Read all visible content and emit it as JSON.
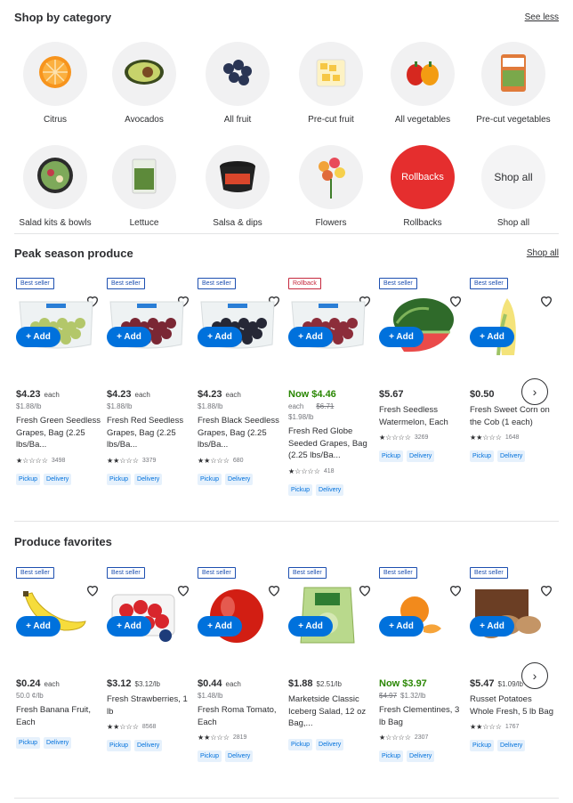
{
  "category": {
    "title": "Shop by category",
    "link": "See less",
    "items": [
      {
        "label": "Citrus",
        "icon": "orange-icon"
      },
      {
        "label": "Avocados",
        "icon": "avocado-icon"
      },
      {
        "label": "All fruit",
        "icon": "blueberries-icon"
      },
      {
        "label": "Pre-cut fruit",
        "icon": "pineapple-chunks-icon"
      },
      {
        "label": "All vegetables",
        "icon": "peppers-icon"
      },
      {
        "label": "Pre-cut vegetables",
        "icon": "veggie-bag-icon"
      },
      {
        "label": "Salad kits & bowls",
        "icon": "salad-bowl-icon"
      },
      {
        "label": "Lettuce",
        "icon": "lettuce-icon"
      },
      {
        "label": "Salsa & dips",
        "icon": "salsa-tub-icon"
      },
      {
        "label": "Flowers",
        "icon": "flowers-icon"
      },
      {
        "label": "Rollbacks",
        "circle_text": "Rollbacks"
      },
      {
        "label": "Shop all",
        "circle_text": "Shop all"
      }
    ]
  },
  "peak": {
    "title": "Peak season produce",
    "link": "Shop all",
    "products": [
      {
        "badge": "Best seller",
        "price": "$4.23",
        "each": "each",
        "unit": "$1.88/lb",
        "name": "Fresh Green Seedless Grapes, Bag (2.25 lbs/Ba...",
        "reviews": "3498",
        "stars": "★☆☆☆☆",
        "tags": [
          "Pickup",
          "Delivery"
        ]
      },
      {
        "badge": "Best seller",
        "price": "$4.23",
        "each": "each",
        "unit": "$1.88/lb",
        "name": "Fresh Red Seedless Grapes, Bag (2.25 lbs/Ba...",
        "reviews": "3379",
        "stars": "★★☆☆☆",
        "tags": [
          "Pickup",
          "Delivery"
        ]
      },
      {
        "badge": "Best seller",
        "price": "$4.23",
        "each": "each",
        "unit": "$1.88/lb",
        "name": "Fresh Black Seedless Grapes, Bag (2.25 lbs/Ba...",
        "reviews": "680",
        "stars": "★★☆☆☆",
        "tags": [
          "Pickup",
          "Delivery"
        ]
      },
      {
        "badge": "Rollback",
        "price": "Now $4.46",
        "each": "each",
        "was": "$6.71",
        "unit": "$1.98/lb",
        "name": "Fresh Red Globe Seeded Grapes, Bag (2.25 lbs/Ba...",
        "reviews": "418",
        "stars": "★☆☆☆☆",
        "tags": [
          "Pickup",
          "Delivery"
        ]
      },
      {
        "badge": "Best seller",
        "price": "$5.67",
        "each": "",
        "unit": "",
        "name": "Fresh Seedless Watermelon, Each",
        "reviews": "3269",
        "stars": "★☆☆☆☆",
        "tags": [
          "Pickup",
          "Delivery"
        ]
      },
      {
        "badge": "Best seller",
        "price": "$0.50",
        "each": "",
        "unit": "",
        "name": "Fresh Sweet Corn on the Cob (1 each)",
        "reviews": "1648",
        "stars": "★★☆☆☆",
        "tags": [
          "Pickup",
          "Delivery"
        ]
      }
    ],
    "add_label": "+ Add"
  },
  "favorites": {
    "title": "Produce favorites",
    "products": [
      {
        "badge": "Best seller",
        "price": "$0.24",
        "each": "each",
        "unit": "50.0 ¢/lb",
        "name": "Fresh Banana Fruit, Each",
        "reviews": "",
        "stars": "",
        "tags": [
          "Pickup",
          "Delivery"
        ]
      },
      {
        "badge": "Best seller",
        "price": "$3.12",
        "each": "$3.12/lb",
        "unit": "",
        "name": "Fresh Strawberries, 1 lb",
        "reviews": "8568",
        "stars": "★★☆☆☆",
        "tags": [
          "Pickup",
          "Delivery"
        ]
      },
      {
        "badge": "Best seller",
        "price": "$0.44",
        "each": "each",
        "unit": "$1.48/lb",
        "name": "Fresh Roma Tomato, Each",
        "reviews": "2819",
        "stars": "★★☆☆☆",
        "tags": [
          "Pickup",
          "Delivery"
        ]
      },
      {
        "badge": "Best seller",
        "price": "$1.88",
        "each": "$2.51/lb",
        "unit": "",
        "name": "Marketside Classic Iceberg Salad, 12 oz Bag,...",
        "reviews": "",
        "stars": "",
        "tags": [
          "Pickup",
          "Delivery"
        ]
      },
      {
        "badge": "Best seller",
        "price": "Now $3.97",
        "each": "",
        "was": "$4.97",
        "unit": "$1.32/lb",
        "name": "Fresh Clementines, 3 lb Bag",
        "reviews": "2307",
        "stars": "★☆☆☆☆",
        "tags": [
          "Pickup",
          "Delivery"
        ]
      },
      {
        "badge": "Best seller",
        "price": "$5.47",
        "each": "$1.09/lb",
        "unit": "",
        "name": "Russet Potatoes Whole Fresh, 5 lb Bag",
        "reviews": "1767",
        "stars": "★★☆☆☆",
        "tags": [
          "Pickup",
          "Delivery"
        ]
      }
    ]
  },
  "colors": {
    "accent": "#0071dc",
    "rollback": "#c5283d",
    "now": "#2a8703"
  }
}
